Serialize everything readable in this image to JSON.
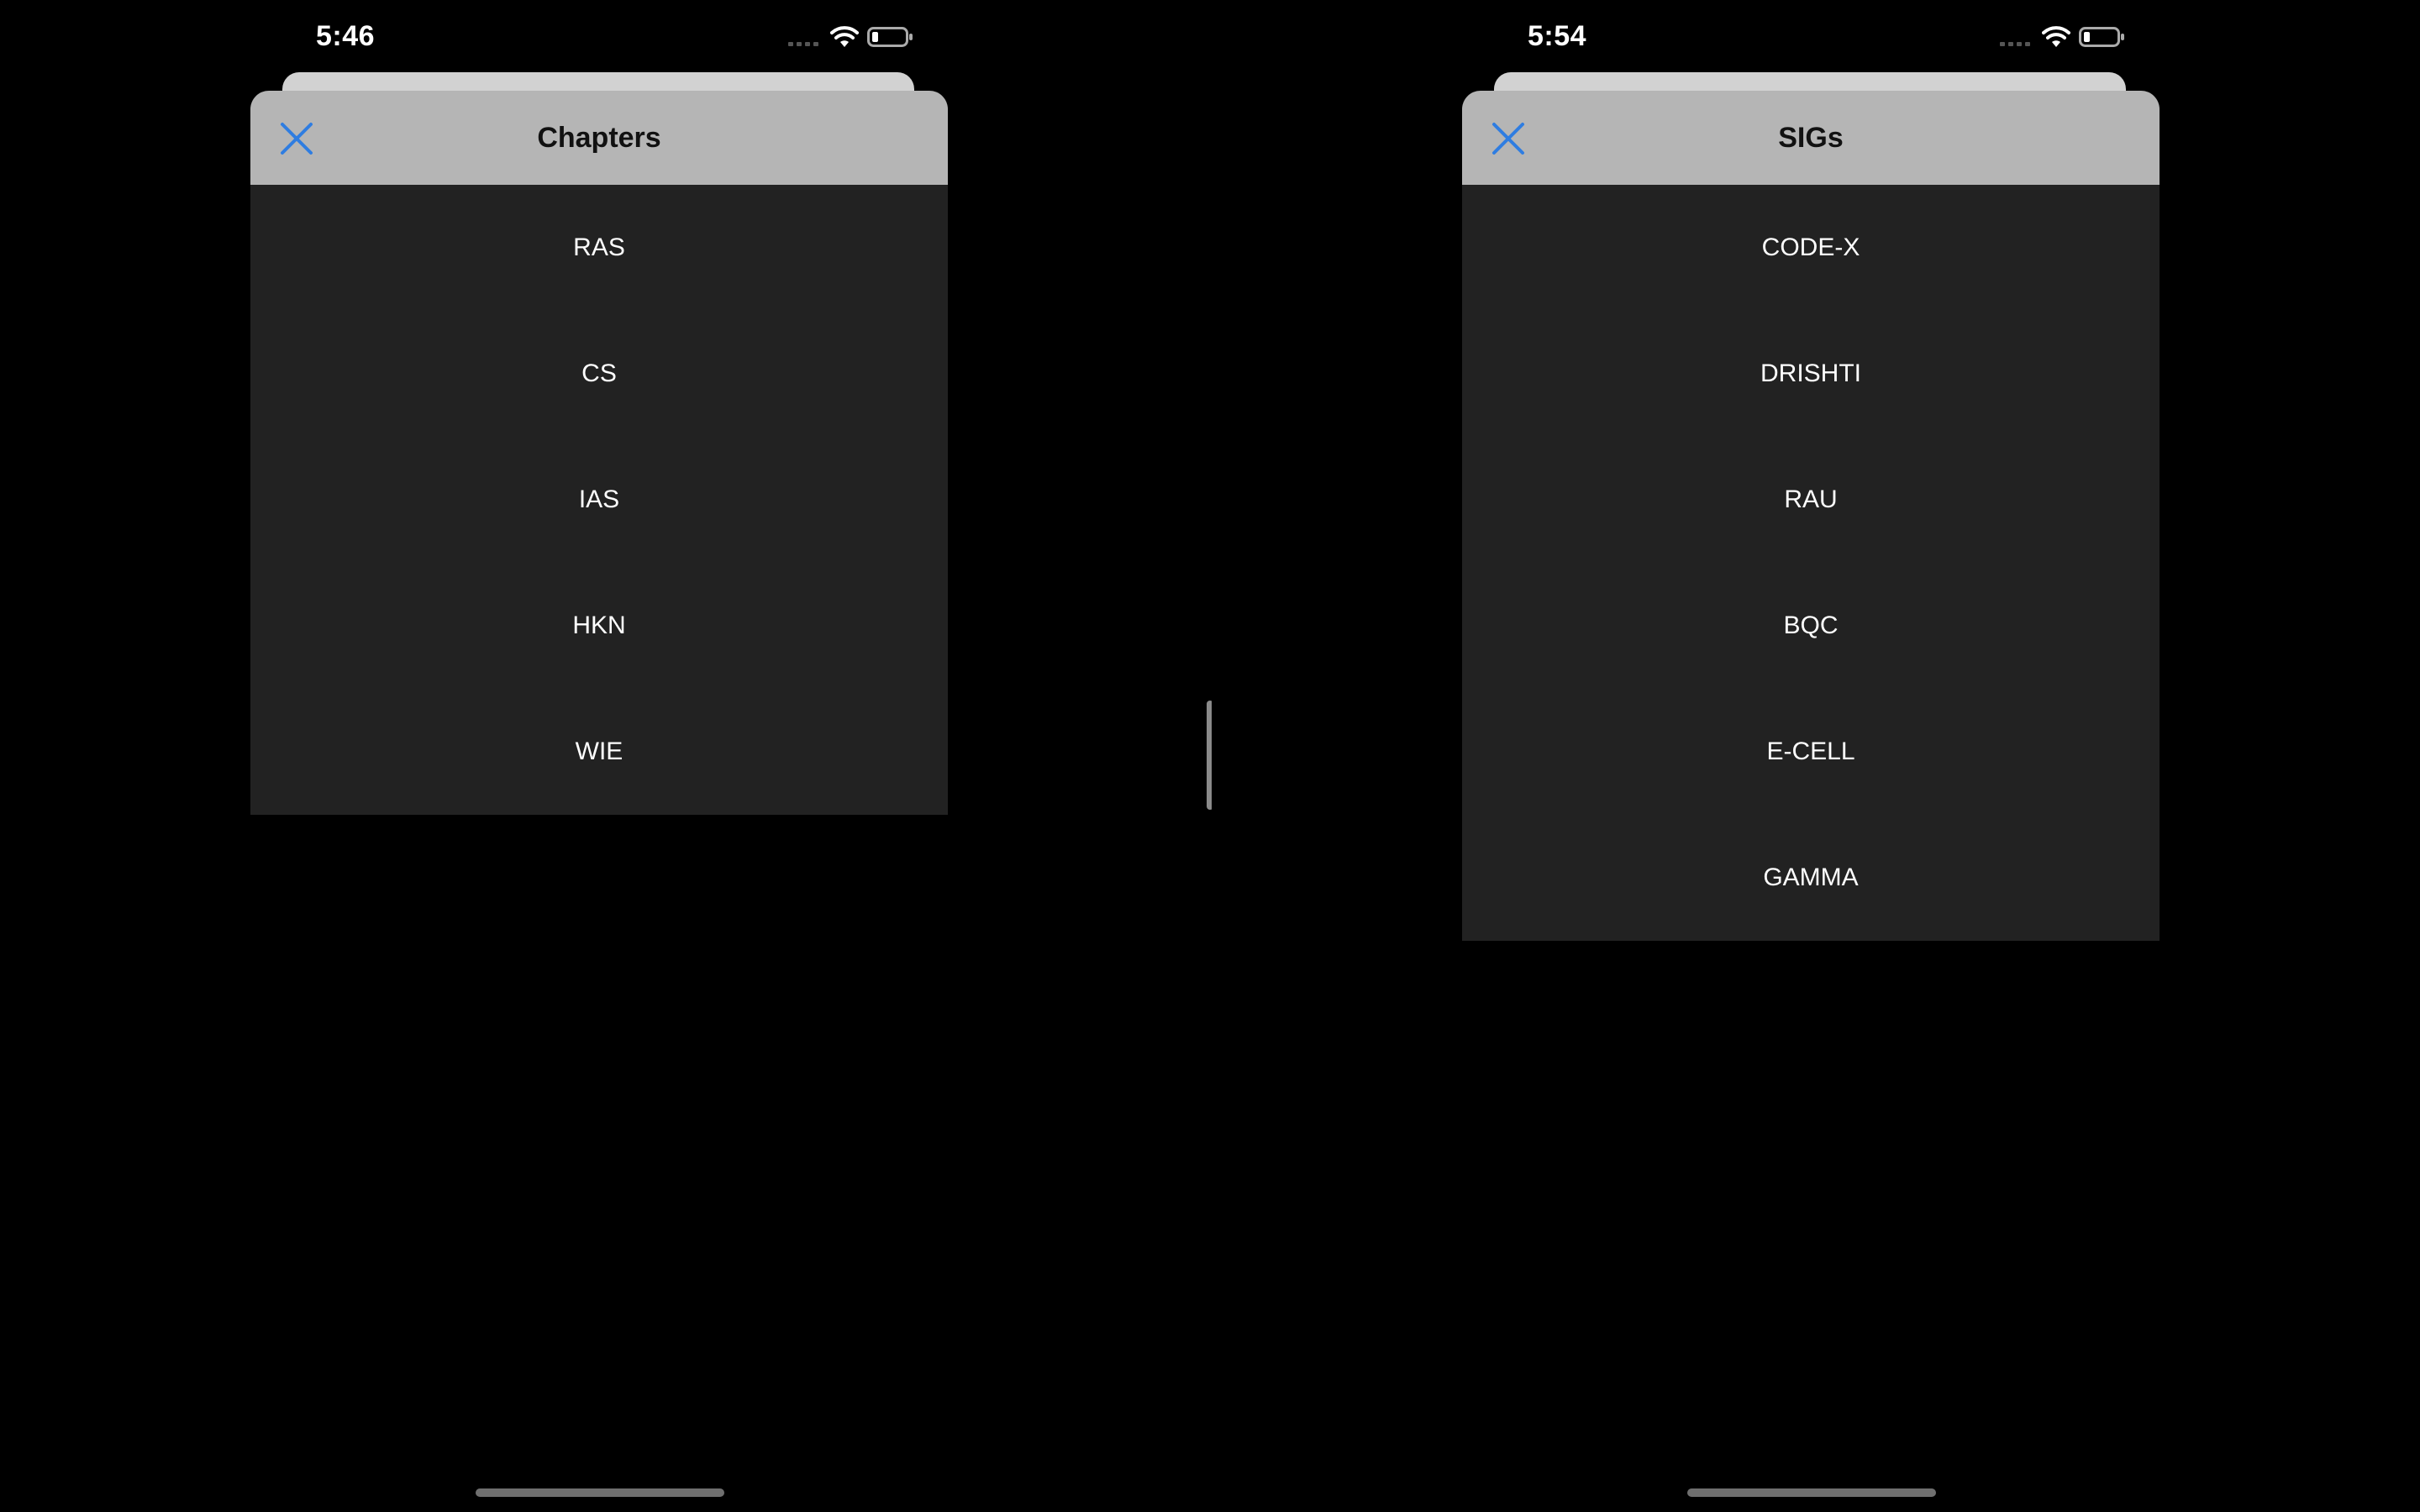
{
  "left_pane": {
    "status_bar": {
      "time": "5:46",
      "icons": [
        "cellular-signal-icon",
        "wifi-icon",
        "battery-icon"
      ]
    },
    "sheet": {
      "title": "Chapters",
      "close_icon": "close-icon",
      "items": [
        {
          "label": "RAS"
        },
        {
          "label": "CS"
        },
        {
          "label": "IAS"
        },
        {
          "label": "HKN"
        },
        {
          "label": "WIE"
        }
      ]
    }
  },
  "right_pane": {
    "status_bar": {
      "time": "5:54",
      "icons": [
        "cellular-signal-icon",
        "wifi-icon",
        "battery-icon"
      ]
    },
    "sheet": {
      "title": "SIGs",
      "close_icon": "close-icon",
      "items": [
        {
          "label": "CODE-X"
        },
        {
          "label": "DRISHTI"
        },
        {
          "label": "RAU"
        },
        {
          "label": "BQC"
        },
        {
          "label": "E-CELL"
        },
        {
          "label": "GAMMA"
        }
      ]
    }
  },
  "colors": {
    "background": "#000000",
    "sheet_header": "#b5b5b5",
    "sheet_body": "#222222",
    "accent_close": "#2f7de1",
    "list_text": "#ffffff",
    "title_text": "#111111"
  }
}
